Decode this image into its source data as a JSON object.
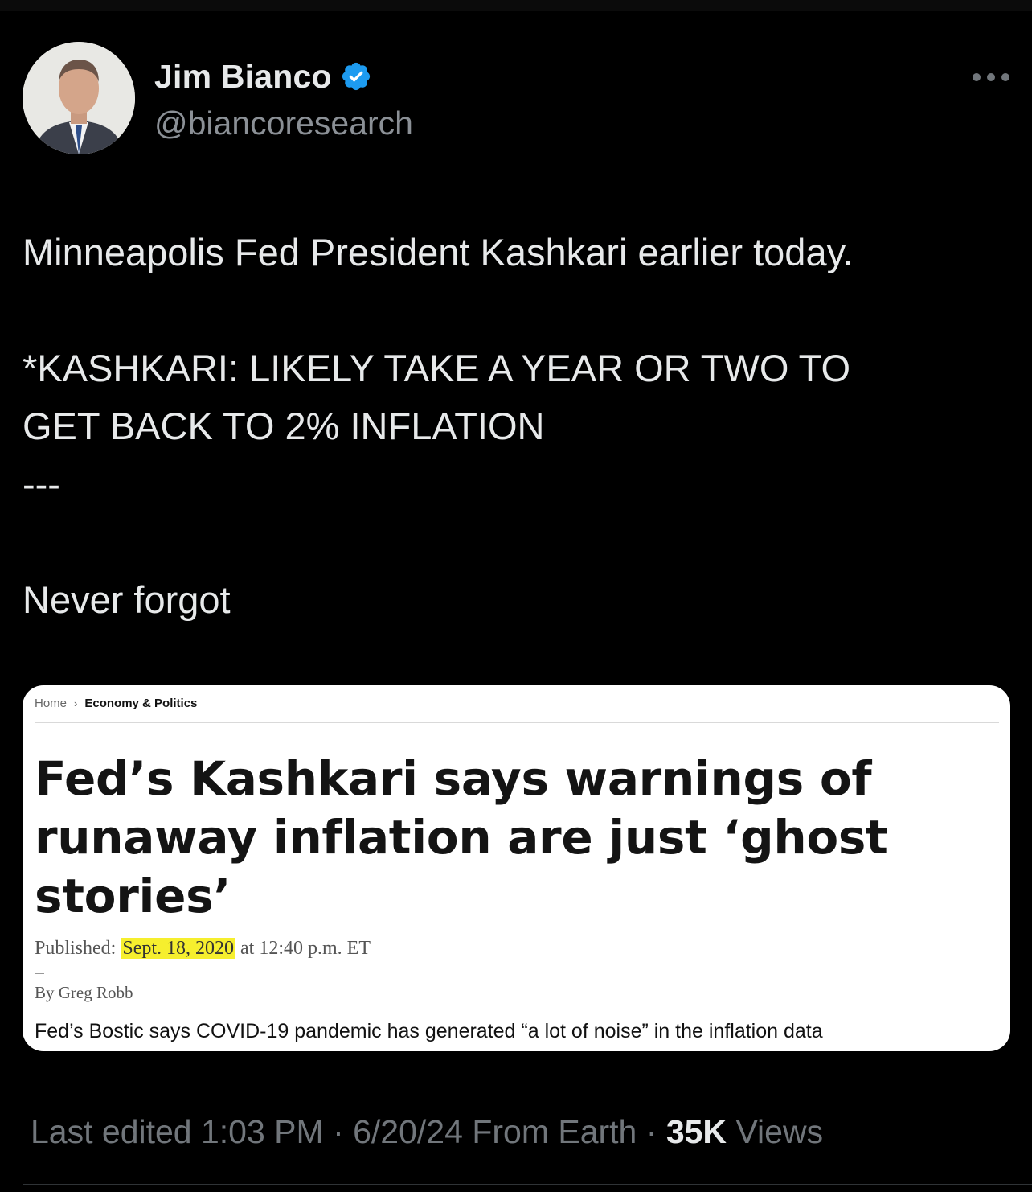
{
  "colors": {
    "background": "#000000",
    "text_primary": "#e7e9ea",
    "text_secondary": "#71767b",
    "verified_blue": "#1d9bf0",
    "highlight_yellow": "#f6ef2e"
  },
  "author": {
    "display_name": "Jim Bianco",
    "handle": "@biancoresearch",
    "verified_icon": "verified-badge-icon",
    "avatar_icon": "profile-photo"
  },
  "more_menu_icon": "more-horizontal-icon",
  "tweet": {
    "line1": "Minneapolis Fed President Kashkari earlier today.",
    "line2": "*KASHKARI: LIKELY TAKE A YEAR OR TWO TO",
    "line3": "GET BACK TO 2% INFLATION",
    "line4": "---",
    "line5": "Never forgot"
  },
  "media": {
    "breadcrumb_home": "Home",
    "breadcrumb_chevron": "›",
    "breadcrumb_section": "Economy & Politics",
    "headline_line1": "Fed’s Kashkari says warnings of",
    "headline_line2": "runaway inflation are just ‘ghost",
    "headline_line3": "stories’",
    "published_label": "Published:",
    "published_date": "Sept. 18, 2020",
    "published_time": "at 12:40 p.m. ET",
    "byline": "By Greg Robb",
    "related_headline": "Fed’s Bostic says COVID-19 pandemic has generated “a lot of noise” in the inflation data"
  },
  "meta": {
    "edited": "Last edited 1:03 PM · 6/20/24",
    "source": "From Earth ·",
    "views_count": "35K",
    "views_label": "Views"
  }
}
